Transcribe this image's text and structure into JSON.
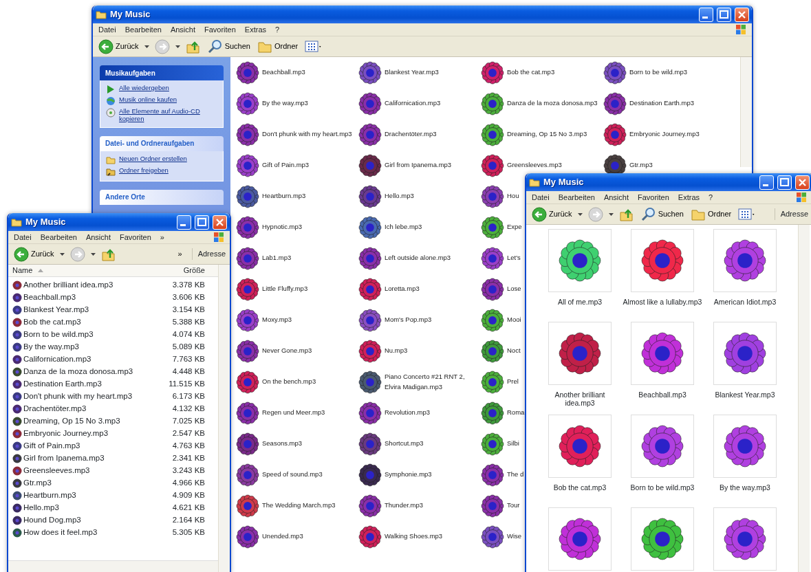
{
  "background_window": {
    "title": "My Music",
    "menu": [
      "Datei",
      "Bearbeiten",
      "Ansicht",
      "Favoriten",
      "Extras",
      "?"
    ],
    "toolbar": [
      {
        "kind": "back",
        "label": "Zurück"
      },
      {
        "kind": "forward"
      },
      {
        "kind": "up"
      },
      {
        "kind": "search",
        "label": "Suchen"
      },
      {
        "kind": "folders",
        "label": "Ordner"
      },
      {
        "kind": "views"
      }
    ],
    "task_panels": [
      {
        "title": "Musikaufgaben",
        "items": [
          {
            "kind": "play",
            "label": "Alle wiedergeben"
          },
          {
            "kind": "globe",
            "label": "Musik online kaufen"
          },
          {
            "kind": "disc",
            "label": "Alle Elemente auf Audio-CD kopieren"
          }
        ]
      },
      {
        "title": "Datei- und Ordneraufgaben",
        "items": [
          {
            "kind": "new-folder",
            "label": "Neuen Ordner erstellen"
          },
          {
            "kind": "share",
            "label": "Ordner freigeben"
          }
        ]
      },
      {
        "title": "Andere Orte"
      }
    ],
    "tile_rows": [
      [
        {
          "name": "Beachball.mp3",
          "color": "#8a2fa8"
        },
        {
          "name": "Blankest Year.mp3",
          "color": "#7a4fc0"
        },
        {
          "name": "Bob the cat.mp3",
          "color": "#d0206a"
        },
        {
          "name": "Born to be wild.mp3",
          "color": "#7a4fc0"
        }
      ],
      [
        {
          "name": "By the way.mp3",
          "color": "#9a3fc8"
        },
        {
          "name": "Californication.mp3",
          "color": "#8a2fa8"
        },
        {
          "name": "Danza de la moza donosa.mp3",
          "color": "#4caf3c"
        },
        {
          "name": "Destination Earth.mp3",
          "color": "#8a2fa8"
        }
      ],
      [
        {
          "name": "Don't phunk with my heart.mp3",
          "color": "#8a2fa8"
        },
        {
          "name": "Drachentöter.mp3",
          "color": "#8a2fa8"
        },
        {
          "name": "Dreaming, Op 15 No 3.mp3",
          "color": "#4caf3c"
        },
        {
          "name": "Embryonic Journey.mp3",
          "color": "#d0205a"
        }
      ],
      [
        {
          "name": "Gift of Pain.mp3",
          "color": "#9a3fc8"
        },
        {
          "name": "Girl from Ipanema.mp3",
          "color": "#6a2a4a"
        },
        {
          "name": "Greensleeves.mp3",
          "color": "#d0205a"
        },
        {
          "name": "Gtr.mp3",
          "color": "#4a4040"
        }
      ],
      [
        {
          "name": "Heartburn.mp3",
          "color": "#4a5aa0"
        },
        {
          "name": "Hello.mp3",
          "color": "#6a3a90"
        },
        {
          "name": "Hou",
          "color": "#8a3fb0"
        }
      ],
      [
        {
          "name": "Hypnotic.mp3",
          "color": "#8a2fa8"
        },
        {
          "name": "Ich lebe.mp3",
          "color": "#4a6ab0"
        },
        {
          "name": "Expe",
          "color": "#4caf3c"
        }
      ],
      [
        {
          "name": "Lab1.mp3",
          "color": "#8a2fa8"
        },
        {
          "name": "Left outside alone.mp3",
          "color": "#8a2fa8"
        },
        {
          "name": "Let's",
          "color": "#9a3fc8"
        }
      ],
      [
        {
          "name": "Little Fluffy.mp3",
          "color": "#d0205a"
        },
        {
          "name": "Loretta.mp3",
          "color": "#d0205a"
        },
        {
          "name": "Lose",
          "color": "#8a2fa8"
        }
      ],
      [
        {
          "name": "Moxy.mp3",
          "color": "#9a3fc8"
        },
        {
          "name": "Mom's Pop.mp3",
          "color": "#8a4fc0"
        },
        {
          "name": "Mooi",
          "color": "#4caf3c"
        }
      ],
      [
        {
          "name": "Never Gone.mp3",
          "color": "#8a2fa8"
        },
        {
          "name": "Nu.mp3",
          "color": "#d0205a"
        },
        {
          "name": "Noct",
          "color": "#3f9a3c"
        }
      ],
      [
        {
          "name": "On the bench.mp3",
          "color": "#d0205a"
        },
        {
          "name": "Piano Concerto #21 RNT 2, Elvira Madigan.mp3",
          "color": "#4a5a70"
        },
        {
          "name": "Prel",
          "color": "#4caf3c"
        }
      ],
      [
        {
          "name": "Regen und Meer.mp3",
          "color": "#8a2fa8"
        },
        {
          "name": "Revolution.mp3",
          "color": "#8a2fa8"
        },
        {
          "name": "Roma",
          "color": "#3f9a3c"
        }
      ],
      [
        {
          "name": "Seasons.mp3",
          "color": "#7a2a8a"
        },
        {
          "name": "Shortcut.mp3",
          "color": "#6a3a80"
        },
        {
          "name": "Silbi",
          "color": "#4caf3c"
        }
      ],
      [
        {
          "name": "Speed of sound.mp3",
          "color": "#8a3aa0"
        },
        {
          "name": "Symphonie.mp3",
          "color": "#3a2a50"
        },
        {
          "name": "The d",
          "color": "#8a2fa8"
        }
      ],
      [
        {
          "name": "The Wedding March.mp3",
          "color": "#d03a4a"
        },
        {
          "name": "Thunder.mp3",
          "color": "#8a2fa8"
        },
        {
          "name": "Tour",
          "color": "#8a2fa8"
        }
      ],
      [
        {
          "name": "Unended.mp3",
          "color": "#8a2fa8"
        },
        {
          "name": "Walking Shoes.mp3",
          "color": "#d0205a"
        },
        {
          "name": "Wise",
          "color": "#7a4fc0"
        }
      ]
    ]
  },
  "list_window": {
    "title": "My Music",
    "menu": [
      "Datei",
      "Bearbeiten",
      "Ansicht",
      "Favoriten",
      "»"
    ],
    "toolbar": [
      {
        "kind": "back",
        "label": "Zurück"
      },
      {
        "kind": "forward"
      },
      {
        "kind": "up"
      },
      {
        "kind": "more",
        "label": "»"
      }
    ],
    "address_label": "Adresse",
    "columns": [
      "Name",
      "Größe"
    ],
    "rows": [
      {
        "name": "Another brilliant idea.mp3",
        "size": "3.378 KB",
        "color": "#8a2a3a"
      },
      {
        "name": "Beachball.mp3",
        "size": "3.606 KB",
        "color": "#4a2a70"
      },
      {
        "name": "Blankest Year.mp3",
        "size": "3.154 KB",
        "color": "#3a3a80"
      },
      {
        "name": "Bob the cat.mp3",
        "size": "5.388 KB",
        "color": "#8a2a3a"
      },
      {
        "name": "Born to be wild.mp3",
        "size": "4.074 KB",
        "color": "#3a3a80"
      },
      {
        "name": "By the way.mp3",
        "size": "5.089 KB",
        "color": "#3a3a80"
      },
      {
        "name": "Californication.mp3",
        "size": "7.763 KB",
        "color": "#4a2a70"
      },
      {
        "name": "Danza de la moza donosa.mp3",
        "size": "4.448 KB",
        "color": "#3a4a30"
      },
      {
        "name": "Destination Earth.mp3",
        "size": "11.515 KB",
        "color": "#4a2a70"
      },
      {
        "name": "Don't phunk with my heart.mp3",
        "size": "6.173 KB",
        "color": "#3a3a80"
      },
      {
        "name": "Drachentöter.mp3",
        "size": "4.132 KB",
        "color": "#4a2a70"
      },
      {
        "name": "Dreaming, Op 15 No 3.mp3",
        "size": "7.025 KB",
        "color": "#3a4a30"
      },
      {
        "name": "Embryonic Journey.mp3",
        "size": "2.547 KB",
        "color": "#8a2a3a"
      },
      {
        "name": "Gift of Pain.mp3",
        "size": "4.763 KB",
        "color": "#3a3a80"
      },
      {
        "name": "Girl from Ipanema.mp3",
        "size": "2.341 KB",
        "color": "#3a3a40"
      },
      {
        "name": "Greensleeves.mp3",
        "size": "3.243 KB",
        "color": "#8a2a3a"
      },
      {
        "name": "Gtr.mp3",
        "size": "4.966 KB",
        "color": "#3a3a40"
      },
      {
        "name": "Heartburn.mp3",
        "size": "4.909 KB",
        "color": "#3a4a70"
      },
      {
        "name": "Hello.mp3",
        "size": "4.621 KB",
        "color": "#3a2a60"
      },
      {
        "name": "Hound Dog.mp3",
        "size": "2.164 KB",
        "color": "#3a2a60"
      },
      {
        "name": "How does it feel.mp3",
        "size": "5.305 KB",
        "color": "#2a5a4a"
      }
    ]
  },
  "thumbnail_window": {
    "title": "My Music",
    "menu": [
      "Datei",
      "Bearbeiten",
      "Ansicht",
      "Favoriten",
      "Extras",
      "?"
    ],
    "toolbar": [
      {
        "kind": "back",
        "label": "Zurück"
      },
      {
        "kind": "forward"
      },
      {
        "kind": "up"
      },
      {
        "kind": "search",
        "label": "Suchen"
      },
      {
        "kind": "folders",
        "label": "Ordner"
      },
      {
        "kind": "views"
      }
    ],
    "address_label": "Adresse",
    "tiles": [
      {
        "name": "All of me.mp3",
        "color": "#3fd070"
      },
      {
        "name": "Almost like a lullaby.mp3",
        "color": "#f0284a"
      },
      {
        "name": "American Idiot.mp3",
        "color": "#b040e0"
      },
      {
        "name": "Another brilliant idea.mp3",
        "color": "#c02048"
      },
      {
        "name": "Beachball.mp3",
        "color": "#c030d8"
      },
      {
        "name": "Blankest Year.mp3",
        "color": "#a040e0"
      },
      {
        "name": "Bob the cat.mp3",
        "color": "#e0205a"
      },
      {
        "name": "Born to be wild.mp3",
        "color": "#b040e0"
      },
      {
        "name": "By the way.mp3",
        "color": "#b040e0"
      },
      {
        "color": "#c030d8"
      },
      {
        "color": "#3fc040"
      },
      {
        "color": "#b040e0"
      }
    ]
  }
}
